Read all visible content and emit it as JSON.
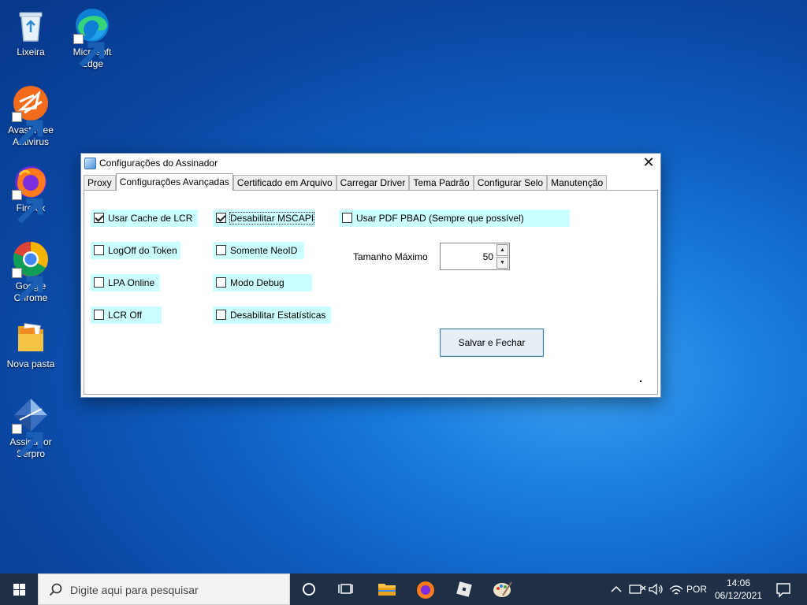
{
  "desktop": {
    "icons": [
      {
        "label": "Lixeira"
      },
      {
        "label": "Microsoft Edge"
      },
      {
        "label": "Avast Free Antivirus"
      },
      {
        "label": "Firefox"
      },
      {
        "label": "Google Chrome"
      },
      {
        "label": "Nova pasta"
      },
      {
        "label": "Assinador Serpro"
      }
    ]
  },
  "dialog": {
    "title": "Configurações do Assinador",
    "close_symbol": "✕",
    "tabs": [
      {
        "label": "Proxy",
        "active": false
      },
      {
        "label": "Configurações Avançadas",
        "active": true
      },
      {
        "label": "Certificado em Arquivo",
        "active": false
      },
      {
        "label": "Carregar Driver",
        "active": false
      },
      {
        "label": "Tema Padrão",
        "active": false
      },
      {
        "label": "Configurar Selo",
        "active": false
      },
      {
        "label": "Manutenção",
        "active": false
      }
    ],
    "checkboxes": {
      "usar_cache_lcr": {
        "label": "Usar Cache de LCR",
        "checked": true
      },
      "desabilitar_mscapi": {
        "label": "Desabilitar MSCAPI",
        "checked": true
      },
      "usar_pdf_pbad": {
        "label": "Usar PDF PBAD (Sempre que possível)",
        "checked": false
      },
      "logoff_token": {
        "label": "LogOff do Token",
        "checked": false
      },
      "somente_neoid": {
        "label": "Somente NeoID",
        "checked": false
      },
      "lpa_online": {
        "label": "LPA Online",
        "checked": false
      },
      "modo_debug": {
        "label": "Modo Debug",
        "checked": false
      },
      "lcr_off": {
        "label": "LCR Off",
        "checked": false
      },
      "desabilitar_estatisticas": {
        "label": "Desabilitar Estatísticas",
        "checked": false
      }
    },
    "tamanho_maximo": {
      "label": "Tamanho Máximo",
      "value": "50"
    },
    "save_button": "Salvar e Fechar",
    "colors": {
      "checkbox_bg": "#ccffff",
      "button_border": "#3c7fb1"
    }
  },
  "taskbar": {
    "search_placeholder": "Digite aqui para pesquisar",
    "language": "POR",
    "time": "14:06",
    "date": "06/12/2021",
    "pinned": [
      "task-view-icon",
      "file-explorer-icon",
      "firefox-icon",
      "roblox-icon",
      "paint-icon"
    ]
  }
}
